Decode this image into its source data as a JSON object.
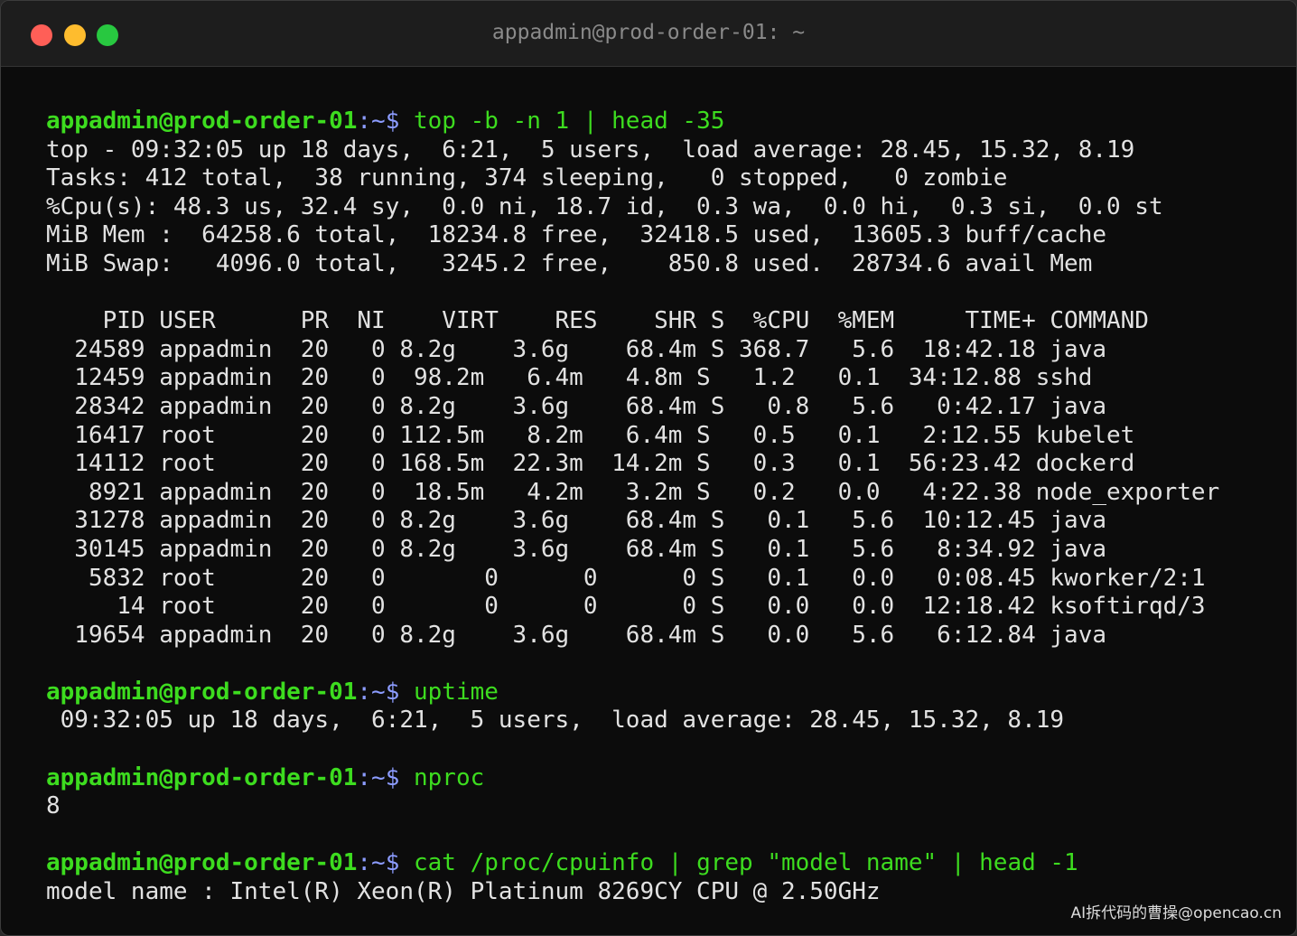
{
  "window": {
    "title": "appadmin@prod-order-01: ~",
    "traffic_lights": {
      "close": "#ff5f57",
      "minimize": "#febc2e",
      "maximize": "#28c840"
    }
  },
  "colors": {
    "user": "#3ddc1f",
    "path": "#8c9cff",
    "command": "#3ddc1f",
    "output": "#e2e2e2",
    "background": "#0c0c0c"
  },
  "prompt": {
    "user_host": "appadmin@prod-order-01",
    "path": ":~",
    "symbol": "$ "
  },
  "sessions": [
    {
      "command": "top -b -n 1 | head -35",
      "output": [
        "top - 09:32:05 up 18 days,  6:21,  5 users,  load average: 28.45, 15.32, 8.19",
        "Tasks: 412 total,  38 running, 374 sleeping,   0 stopped,   0 zombie",
        "%Cpu(s): 48.3 us, 32.4 sy,  0.0 ni, 18.7 id,  0.3 wa,  0.0 hi,  0.3 si,  0.0 st",
        "MiB Mem :  64258.6 total,  18234.8 free,  32418.5 used,  13605.3 buff/cache",
        "MiB Swap:   4096.0 total,   3245.2 free,    850.8 used.  28734.6 avail Mem",
        "",
        "    PID USER      PR  NI    VIRT    RES    SHR S  %CPU  %MEM     TIME+ COMMAND",
        "  24589 appadmin  20   0 8.2g    3.6g    68.4m S 368.7   5.6  18:42.18 java",
        "  12459 appadmin  20   0  98.2m   6.4m   4.8m S   1.2   0.1  34:12.88 sshd",
        "  28342 appadmin  20   0 8.2g    3.6g    68.4m S   0.8   5.6   0:42.17 java",
        "  16417 root      20   0 112.5m   8.2m   6.4m S   0.5   0.1   2:12.55 kubelet",
        "  14112 root      20   0 168.5m  22.3m  14.2m S   0.3   0.1  56:23.42 dockerd",
        "   8921 appadmin  20   0  18.5m   4.2m   3.2m S   0.2   0.0   4:22.38 node_exporter",
        "  31278 appadmin  20   0 8.2g    3.6g    68.4m S   0.1   5.6  10:12.45 java",
        "  30145 appadmin  20   0 8.2g    3.6g    68.4m S   0.1   5.6   8:34.92 java",
        "   5832 root      20   0       0      0      0 S   0.1   0.0   0:08.45 kworker/2:1",
        "     14 root      20   0       0      0      0 S   0.0   0.0  12:18.42 ksoftirqd/3",
        "  19654 appadmin  20   0 8.2g    3.6g    68.4m S   0.0   5.6   6:12.84 java"
      ]
    },
    {
      "command": "uptime",
      "output": [
        " 09:32:05 up 18 days,  6:21,  5 users,  load average: 28.45, 15.32, 8.19"
      ]
    },
    {
      "command": "nproc",
      "output": [
        "8"
      ]
    },
    {
      "command": "cat /proc/cpuinfo | grep \"model name\" | head -1",
      "output": [
        "model name : Intel(R) Xeon(R) Platinum 8269CY CPU @ 2.50GHz"
      ]
    }
  ],
  "watermark": "AI拆代码的曹操@opencao.cn"
}
